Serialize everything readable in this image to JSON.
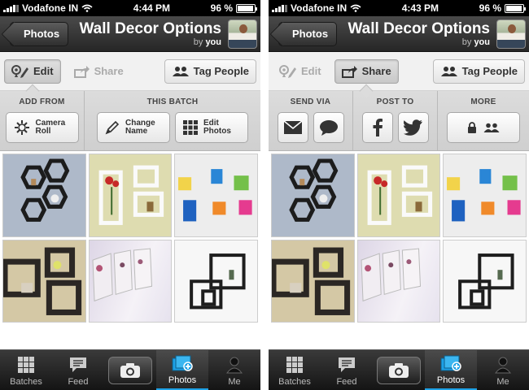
{
  "screens": [
    {
      "status": {
        "carrier": "Vodafone IN",
        "time": "4:44 PM",
        "battery": "96 %",
        "battery_level": 0.96
      },
      "nav": {
        "back_label": "Photos",
        "title": "Wall Decor Options",
        "sub_prefix": "by",
        "sub_user": "you"
      },
      "toolbar": {
        "edit_label": "Edit",
        "share_label": "Share",
        "tag_label": "Tag People",
        "active": "edit"
      },
      "panel": {
        "groups": [
          {
            "label": "ADD FROM",
            "buttons": [
              {
                "label": "Camera\nRoll",
                "icon": "camera-roll-icon"
              }
            ]
          },
          {
            "label": "THIS BATCH",
            "buttons": [
              {
                "label": "Change\nName",
                "icon": "pencil-icon"
              },
              {
                "label": "Edit\nPhotos",
                "icon": "grid-icon"
              }
            ]
          }
        ]
      },
      "tabs": [
        {
          "label": "Batches",
          "icon": "batches-icon"
        },
        {
          "label": "Feed",
          "icon": "feed-icon"
        },
        {
          "label": "",
          "icon": "camera-icon"
        },
        {
          "label": "Photos",
          "icon": "photos-icon"
        },
        {
          "label": "Me",
          "icon": "person-icon"
        }
      ],
      "active_tab": "Photos"
    },
    {
      "status": {
        "carrier": "Vodafone IN",
        "time": "4:43 PM",
        "battery": "96 %",
        "battery_level": 0.96
      },
      "nav": {
        "back_label": "Photos",
        "title": "Wall Decor Options",
        "sub_prefix": "by",
        "sub_user": "you"
      },
      "toolbar": {
        "edit_label": "Edit",
        "share_label": "Share",
        "tag_label": "Tag People",
        "active": "share"
      },
      "panel": {
        "groups": [
          {
            "label": "SEND VIA",
            "buttons": [
              {
                "icon": "envelope-icon"
              },
              {
                "icon": "chat-bubble-icon"
              }
            ]
          },
          {
            "label": "POST TO",
            "buttons": [
              {
                "icon": "facebook-icon"
              },
              {
                "icon": "twitter-icon"
              }
            ]
          },
          {
            "label": "MORE",
            "buttons": [
              {
                "icon": "lock-icon"
              }
            ]
          }
        ]
      },
      "tabs": [
        {
          "label": "Batches",
          "icon": "batches-icon"
        },
        {
          "label": "Feed",
          "icon": "feed-icon"
        },
        {
          "label": "",
          "icon": "camera-icon"
        },
        {
          "label": "Photos",
          "icon": "photos-icon"
        },
        {
          "label": "Me",
          "icon": "person-icon"
        }
      ],
      "active_tab": "Photos"
    }
  ],
  "photos": [
    {
      "name": "hexagon-shelves-photo"
    },
    {
      "name": "flower-box-shelves-photo"
    },
    {
      "name": "colorful-cubes-photo"
    },
    {
      "name": "black-square-shelves-photo"
    },
    {
      "name": "floral-canvas-photo"
    },
    {
      "name": "square-frames-photo"
    }
  ]
}
